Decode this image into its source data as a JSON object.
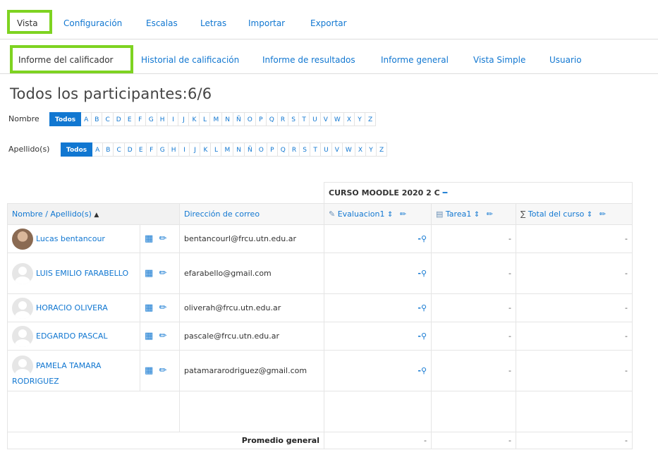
{
  "main_tabs": [
    {
      "label": "Vista",
      "active": true
    },
    {
      "label": "Configuración"
    },
    {
      "label": "Escalas"
    },
    {
      "label": "Letras"
    },
    {
      "label": "Importar"
    },
    {
      "label": "Exportar"
    }
  ],
  "sub_tabs": [
    {
      "label": "Informe del calificador",
      "active": true
    },
    {
      "label": "Historial de calificación"
    },
    {
      "label": "Informe de resultados"
    },
    {
      "label": "Informe general"
    },
    {
      "label": "Vista Simple"
    },
    {
      "label": "Usuario"
    }
  ],
  "page_title": "Todos los participantes:6/6",
  "filters": {
    "first_name_label": "Nombre",
    "last_name_label": "Apellido(s)",
    "all_label": "Todos",
    "letters": [
      "A",
      "B",
      "C",
      "D",
      "E",
      "F",
      "G",
      "H",
      "I",
      "J",
      "K",
      "L",
      "M",
      "N",
      "Ñ",
      "O",
      "P",
      "Q",
      "R",
      "S",
      "T",
      "U",
      "V",
      "W",
      "X",
      "Y",
      "Z"
    ]
  },
  "table": {
    "course_header": "CURSO MOODLE 2020 2 C",
    "collapse_icon": "minus-icon",
    "columns": {
      "name": "Nombre / Apellido(s)",
      "email": "Dirección de correo",
      "eval": "Evaluacion1",
      "task": "Tarea1",
      "total": "Total del curso"
    },
    "sort_icon": "caret-up-icon",
    "rows": [
      {
        "name": "Lucas bentancour",
        "email": "bentancourl@frcu.utn.edu.ar",
        "photo": true
      },
      {
        "name": "LUIS EMILIO FARABELLO",
        "email": "efarabello@gmail.com"
      },
      {
        "name": "HORACIO OLIVERA",
        "email": "oliverah@frcu.utn.edu.ar"
      },
      {
        "name": "EDGARDO PASCAL",
        "email": "pascale@frcu.utn.edu.ar"
      },
      {
        "name": "PAMELA TAMARA RODRIGUEZ",
        "email": "patamararodriguez@gmail.com"
      }
    ],
    "grade_dash": "-",
    "footer_label": "Promedio general"
  },
  "accent_color": "#1177d1",
  "highlight_color": "#7ed321"
}
